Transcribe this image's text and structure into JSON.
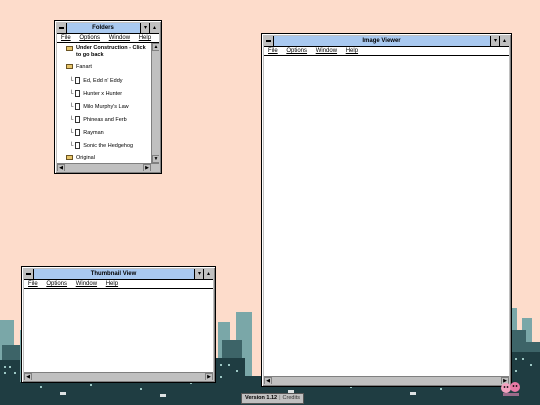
{
  "folders_window": {
    "title": "Folders",
    "menu": [
      "File",
      "Options",
      "Window",
      "Help"
    ],
    "items": [
      {
        "kind": "folder",
        "label": "Under Construction - Click to go back",
        "bold": true
      },
      {
        "kind": "folder",
        "label": "Fanart"
      },
      {
        "kind": "file",
        "label": "Ed, Edd n' Eddy"
      },
      {
        "kind": "file",
        "label": "Hunter x Hunter"
      },
      {
        "kind": "file",
        "label": "Milo Murphy's Law"
      },
      {
        "kind": "file",
        "label": "Phineas and Ferb"
      },
      {
        "kind": "file",
        "label": "Rayman"
      },
      {
        "kind": "file",
        "label": "Sonic the Hedgehog"
      },
      {
        "kind": "folder",
        "label": "Original"
      }
    ]
  },
  "image_viewer_window": {
    "title": "Image Viewer",
    "menu": [
      "File",
      "Options",
      "Window",
      "Help"
    ]
  },
  "thumbnail_window": {
    "title": "Thumbnail View",
    "menu": [
      "File",
      "Options",
      "Window",
      "Help"
    ]
  },
  "status_bar": {
    "version": "Version 1.12",
    "separator": "|",
    "credits": "Credits"
  },
  "colors": {
    "background": "#fddccb",
    "titlebar": "#a9c9f0",
    "city_dark": "#1f3d42",
    "city_mid": "#3d6468"
  }
}
